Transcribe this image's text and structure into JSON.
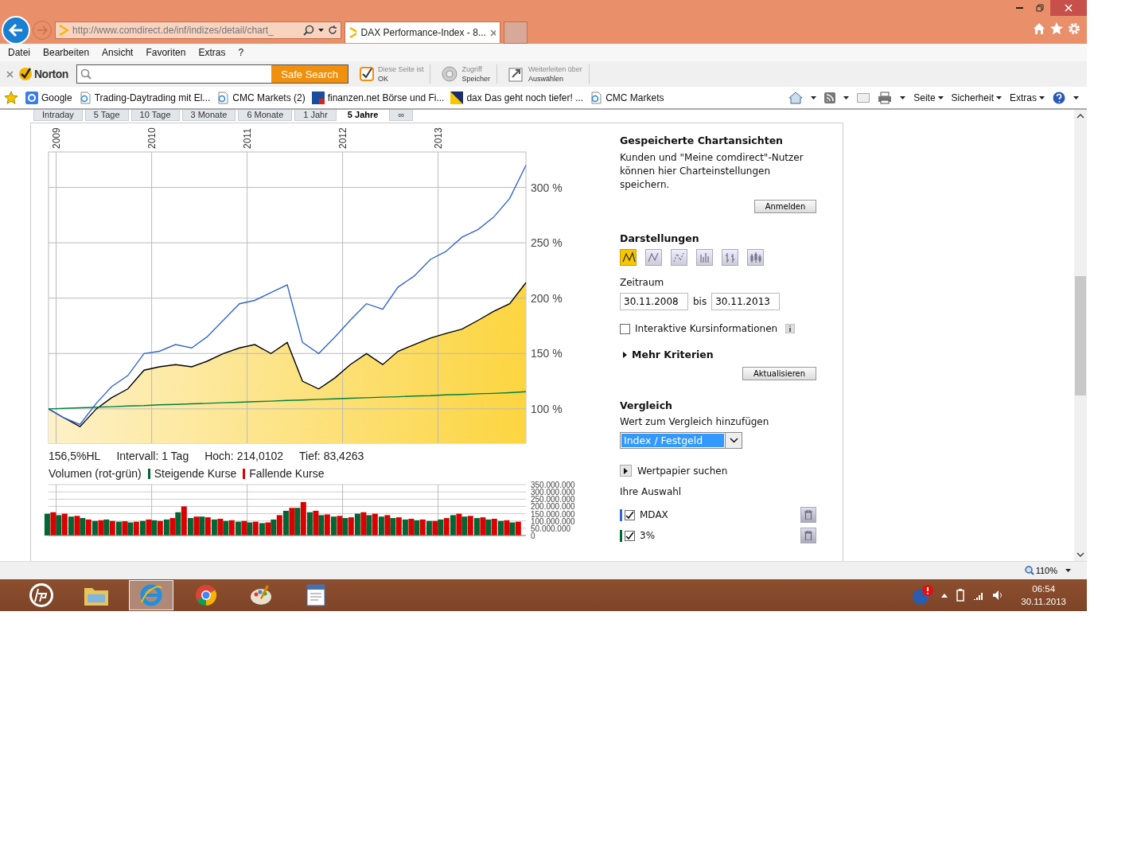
{
  "browser": {
    "address": "http://www.comdirect.de/inf/indizes/detail/chart_",
    "tabs": [
      {
        "title": "DAX Performance-Index - 8...",
        "selected": true
      }
    ],
    "menu": [
      "Datei",
      "Bearbeiten",
      "Ansicht",
      "Favoriten",
      "Extras",
      "?"
    ],
    "norton": {
      "logo": "Norton",
      "search_button": "Safe Search",
      "status": [
        {
          "kind": "check",
          "line1": "Diese Seite ist",
          "line2": "OK"
        },
        {
          "kind": "vault",
          "line1": "Zugriff",
          "line2": "Speicher"
        },
        {
          "kind": "share",
          "line1": "Weiterleiten über",
          "line2": "Auswählen"
        }
      ]
    },
    "favorites": [
      {
        "kind": "google",
        "label": "Google"
      },
      {
        "kind": "ie",
        "label": "Trading-Daytrading mit El..."
      },
      {
        "kind": "ie",
        "label": "CMC Markets (2)"
      },
      {
        "kind": "finanzen",
        "label": "finanzen.net Börse und Fi..."
      },
      {
        "kind": "dax",
        "label": "dax Das geht noch tiefer! ..."
      },
      {
        "kind": "ie",
        "label": "CMC Markets"
      }
    ],
    "command_menus": [
      "Seite",
      "Sicherheit",
      "Extras"
    ]
  },
  "period_tabs": [
    {
      "label": "Intraday",
      "selected": false
    },
    {
      "label": "5 Tage",
      "selected": false
    },
    {
      "label": "10 Tage",
      "selected": false
    },
    {
      "label": "3 Monate",
      "selected": false
    },
    {
      "label": "6 Monate",
      "selected": false
    },
    {
      "label": "1 Jahr",
      "selected": false
    },
    {
      "label": "5 Jahre",
      "selected": true
    },
    {
      "label": "∞",
      "selected": false
    }
  ],
  "chart": {
    "chart_data": {
      "type": "line",
      "grid": true,
      "xlim": [
        2008.92,
        2013.92
      ],
      "ylim": [
        69,
        332
      ],
      "xticks": [
        {
          "value": 2009,
          "label": "2009"
        },
        {
          "value": 2010,
          "label": "2010"
        },
        {
          "value": 2011,
          "label": "2011"
        },
        {
          "value": 2012,
          "label": "2012"
        },
        {
          "value": 2013,
          "label": "2013"
        }
      ],
      "yticks": [
        {
          "value": 100,
          "label": "100 %"
        },
        {
          "value": 150,
          "label": "150 %"
        },
        {
          "value": 200,
          "label": "200 %"
        },
        {
          "value": 250,
          "label": "250 %"
        },
        {
          "value": 300,
          "label": "300 %"
        }
      ],
      "x": [
        2008.92,
        2009.08,
        2009.25,
        2009.42,
        2009.58,
        2009.75,
        2009.92,
        2010.08,
        2010.25,
        2010.42,
        2010.58,
        2010.75,
        2010.92,
        2011.08,
        2011.25,
        2011.42,
        2011.58,
        2011.75,
        2011.92,
        2012.08,
        2012.25,
        2012.42,
        2012.58,
        2012.75,
        2012.92,
        2013.08,
        2013.25,
        2013.42,
        2013.58,
        2013.75,
        2013.92
      ],
      "series": [
        {
          "color": "#000000",
          "values": [
            100,
            92,
            84,
            100,
            110,
            118,
            135,
            138,
            140,
            138,
            143,
            150,
            155,
            158,
            150,
            160,
            125,
            118,
            128,
            140,
            150,
            140,
            152,
            158,
            164,
            168,
            172,
            180,
            188,
            195,
            214
          ]
        },
        {
          "color": "#3366cc",
          "values": [
            100,
            92,
            86,
            105,
            120,
            130,
            150,
            152,
            158,
            155,
            165,
            180,
            195,
            198,
            205,
            212,
            160,
            150,
            165,
            180,
            195,
            190,
            210,
            220,
            235,
            242,
            255,
            262,
            273,
            290,
            320
          ]
        },
        {
          "color": "#008040",
          "values": [
            100,
            100.5,
            101,
            101.5,
            102,
            102.6,
            103,
            103.6,
            104,
            104.6,
            105,
            105.6,
            106,
            106.6,
            107,
            107.6,
            108,
            108.6,
            109,
            109.6,
            110,
            110.6,
            111,
            111.6,
            112,
            112.6,
            113,
            113.6,
            114,
            114.6,
            115.5
          ]
        }
      ]
    }
  },
  "stats": [
    "156,5%HL",
    "Intervall: 1 Tag",
    "Hoch: 214,0102",
    "Tief: 83,4263"
  ],
  "volume": {
    "title": "Volumen (rot-grün)",
    "chart_data": {
      "type": "bar",
      "stacked": false,
      "grid": true,
      "xlim": [
        2008.92,
        2013.92
      ],
      "ylim": [
        0,
        350000000
      ],
      "yticks": [
        {
          "value": 0,
          "label": "0"
        },
        {
          "value": 50000000,
          "label": "50.000.000"
        },
        {
          "value": 100000000,
          "label": "100.000.000"
        },
        {
          "value": 150000000,
          "label": "150.000.000"
        },
        {
          "value": 200000000,
          "label": "200.000.000"
        },
        {
          "value": 250000000,
          "label": "250.000.000"
        },
        {
          "value": 300000000,
          "label": "300.000.000"
        },
        {
          "value": 350000000,
          "label": "350.000.000"
        }
      ],
      "x": [
        2008.94,
        2009.06,
        2009.19,
        2009.31,
        2009.44,
        2009.56,
        2009.69,
        2009.81,
        2009.94,
        2010.06,
        2010.19,
        2010.31,
        2010.44,
        2010.56,
        2010.69,
        2010.81,
        2010.94,
        2011.06,
        2011.19,
        2011.31,
        2011.44,
        2011.56,
        2011.69,
        2011.81,
        2011.94,
        2012.06,
        2012.19,
        2012.31,
        2012.44,
        2012.56,
        2012.69,
        2012.81,
        2012.94,
        2013.06,
        2013.19,
        2013.31,
        2013.44,
        2013.56,
        2013.69,
        2013.81
      ],
      "series": [
        {
          "name": "Steigende Kurse",
          "color": "#006633",
          "values": [
            150000000,
            140000000,
            130000000,
            120000000,
            100000000,
            110000000,
            95000000,
            90000000,
            100000000,
            105000000,
            110000000,
            160000000,
            120000000,
            130000000,
            110000000,
            100000000,
            95000000,
            90000000,
            85000000,
            110000000,
            170000000,
            190000000,
            160000000,
            140000000,
            130000000,
            120000000,
            150000000,
            140000000,
            130000000,
            120000000,
            110000000,
            105000000,
            100000000,
            110000000,
            140000000,
            130000000,
            120000000,
            110000000,
            100000000,
            90000000
          ]
        },
        {
          "name": "Fallende Kurse",
          "color": "#dd0000",
          "values": [
            160000000,
            150000000,
            135000000,
            110000000,
            105000000,
            100000000,
            98000000,
            95000000,
            110000000,
            100000000,
            120000000,
            200000000,
            130000000,
            125000000,
            115000000,
            105000000,
            100000000,
            95000000,
            90000000,
            140000000,
            190000000,
            230000000,
            170000000,
            145000000,
            135000000,
            125000000,
            160000000,
            150000000,
            140000000,
            125000000,
            115000000,
            110000000,
            100000000,
            120000000,
            150000000,
            135000000,
            125000000,
            115000000,
            105000000,
            95000000
          ]
        }
      ]
    }
  },
  "panel": {
    "saved": {
      "title": "Gespeicherte Chartansichten",
      "text": "Kunden und \"Meine comdirect\"-Nutzer können hier Charteinstellungen speichern.",
      "button": "Anmelden"
    },
    "display": {
      "title": "Darstellungen",
      "chart_types": [
        {
          "kind": "area",
          "selected": true
        },
        {
          "kind": "line",
          "selected": false
        },
        {
          "kind": "dotted",
          "selected": false
        },
        {
          "kind": "bars",
          "selected": false
        },
        {
          "kind": "ohlc",
          "selected": false
        },
        {
          "kind": "candles",
          "selected": false
        }
      ],
      "period_label": "Zeitraum",
      "from": "30.11.2008",
      "between": "bis",
      "to": "30.11.2013",
      "interactive": {
        "label": "Interaktive Kursinformationen",
        "checked": false
      },
      "more": "Mehr Kriterien",
      "update_button": "Aktualisieren"
    },
    "compare": {
      "title": "Vergleich",
      "add_label": "Wert zum Vergleich hinzufügen",
      "select": "Index / Festgeld",
      "search": "Wertpapier suchen",
      "selection_title": "Ihre Auswahl",
      "selection": [
        {
          "label": "MDAX",
          "checked": true,
          "color": "#3366cc"
        },
        {
          "label": "3%",
          "checked": true,
          "color": "#006633"
        }
      ]
    }
  },
  "status_bar": {
    "zoom": "110%"
  },
  "taskbar": {
    "apps": [
      {
        "kind": "hp",
        "selected": false
      },
      {
        "kind": "folder",
        "selected": false
      },
      {
        "kind": "ie",
        "selected": true
      },
      {
        "kind": "chrome",
        "selected": false
      },
      {
        "kind": "paint",
        "selected": false
      },
      {
        "kind": "doc",
        "selected": false
      }
    ],
    "time": "06:54",
    "date": "30.11.2013"
  }
}
